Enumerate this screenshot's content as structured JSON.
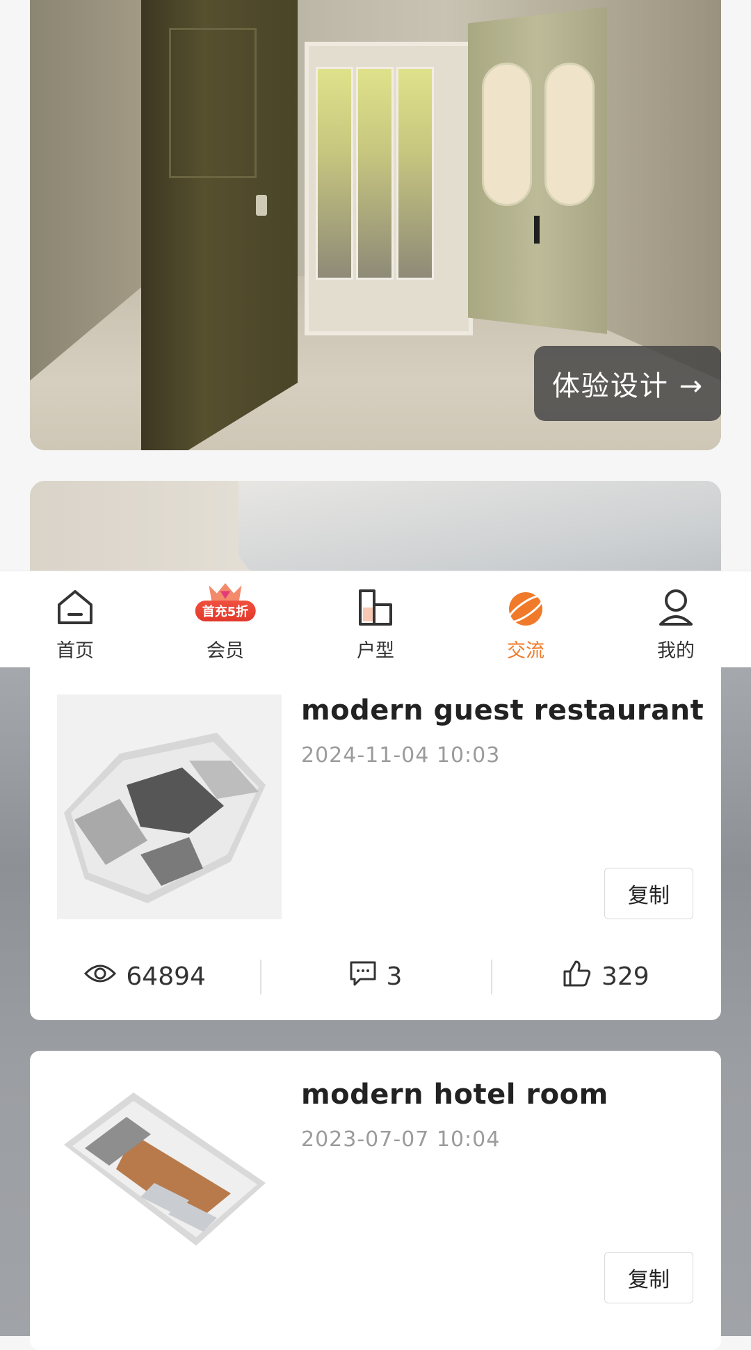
{
  "top": {
    "cta_label": "体验设计 →"
  },
  "tabbar": {
    "items": [
      {
        "label": "首页",
        "icon": "home-icon"
      },
      {
        "label": "会员",
        "icon": "vip-icon",
        "badge": "首充5折"
      },
      {
        "label": "户型",
        "icon": "floorplan-icon"
      },
      {
        "label": "交流",
        "icon": "planet-icon",
        "active": true
      },
      {
        "label": "我的",
        "icon": "user-icon"
      }
    ],
    "accent": "#f07a2a"
  },
  "feed": {
    "posts": [
      {
        "title": "modern guest restaurant",
        "date": "2024-11-04 10:03",
        "copy_label": "复制",
        "views": "64894",
        "comments": "3",
        "likes": "329"
      },
      {
        "title": "modern hotel room",
        "date": "2023-07-07 10:04",
        "copy_label": "复制"
      }
    ]
  }
}
